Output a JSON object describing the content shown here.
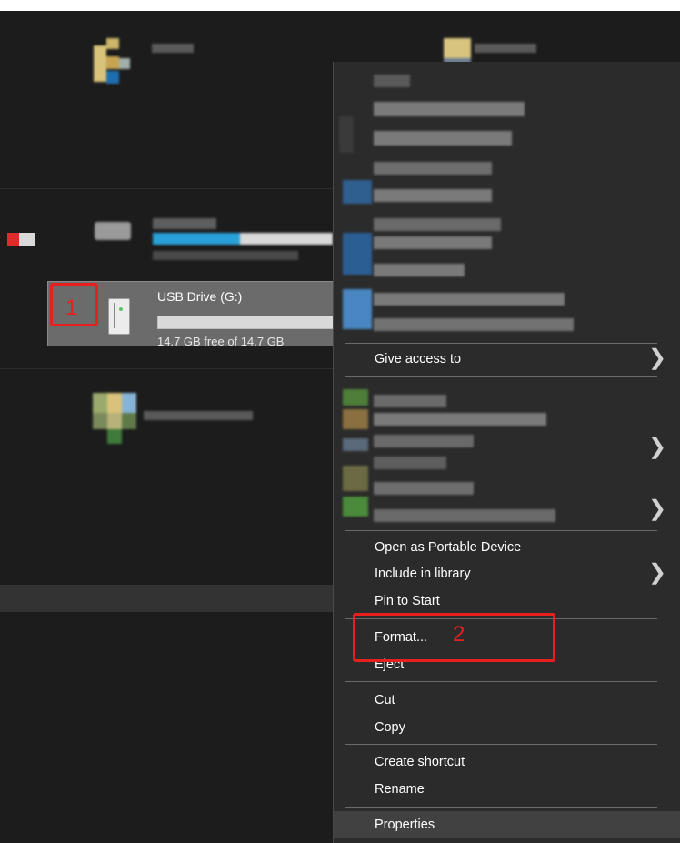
{
  "drive": {
    "name": "USB Drive (G:)",
    "free_space": "14.7 GB free of 14.7 GB",
    "used_fraction": 0.0
  },
  "annotations": [
    {
      "number": "1",
      "color": "#e5201e"
    },
    {
      "number": "2",
      "color": "#e5201e"
    }
  ],
  "context_menu": {
    "items": {
      "give_access_to": "Give access to",
      "open_as_portable_device": "Open as Portable Device",
      "include_in_library": "Include in library",
      "pin_to_start": "Pin to Start",
      "format": "Format...",
      "eject": "Eject",
      "cut": "Cut",
      "copy": "Copy",
      "create_shortcut": "Create shortcut",
      "rename": "Rename",
      "properties": "Properties"
    },
    "submenu_chevron": "❯"
  },
  "colors": {
    "background": "#1c1c1c",
    "menu_background": "#2b2b2b",
    "annotation_red": "#e5201e",
    "accent_blue": "#26a0da"
  }
}
